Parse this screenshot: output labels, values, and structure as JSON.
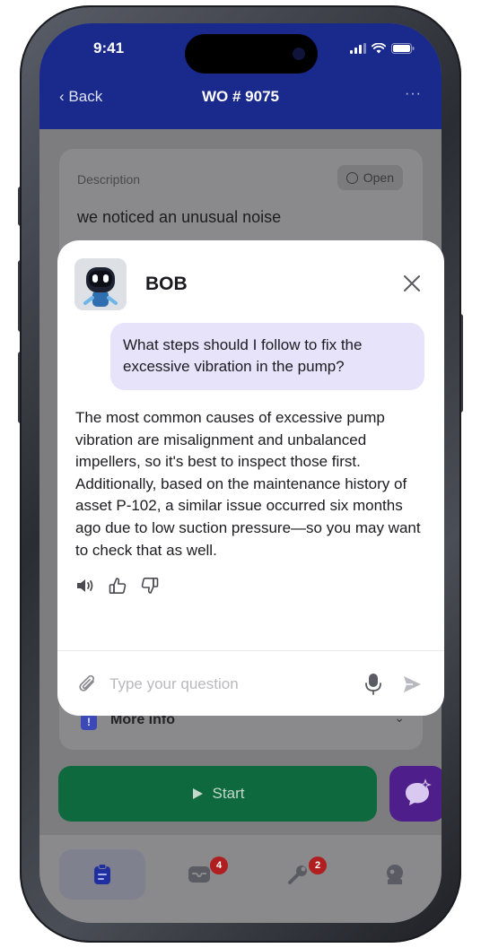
{
  "status_bar": {
    "time": "9:41"
  },
  "nav": {
    "back": "Back",
    "title": "WO  # 9075",
    "more": "···"
  },
  "description": {
    "label": "Description",
    "status": "Open",
    "text": "we noticed an unusual noise"
  },
  "more_info": {
    "label": "More info"
  },
  "actions": {
    "start": "Start"
  },
  "tabs": [
    {
      "icon": "clipboard-icon",
      "badge": "",
      "active": true
    },
    {
      "icon": "inbox-icon",
      "badge": "4",
      "active": false
    },
    {
      "icon": "tools-icon",
      "badge": "2",
      "active": false
    },
    {
      "icon": "profile-icon",
      "badge": "",
      "active": false
    }
  ],
  "chat": {
    "bot_name": "BOB",
    "user_message": "What steps should I follow to fix the excessive vibration in the pump?",
    "bot_message": "The most common causes of excessive pump vibration are misalignment and unbalanced impellers, so it's best to inspect those first. Additionally, based on the maintenance history of asset P-102, a similar issue occurred six months ago due to low suction pressure—so you may want to check that as well.",
    "input_value": "",
    "input_placeholder": "Type your question"
  },
  "colors": {
    "header_bg": "#1a2a8c",
    "start_button": "#0e6a3e",
    "ai_button": "#4e1f8a",
    "user_bubble": "#e6e3fb",
    "badge": "#b01f1f"
  }
}
